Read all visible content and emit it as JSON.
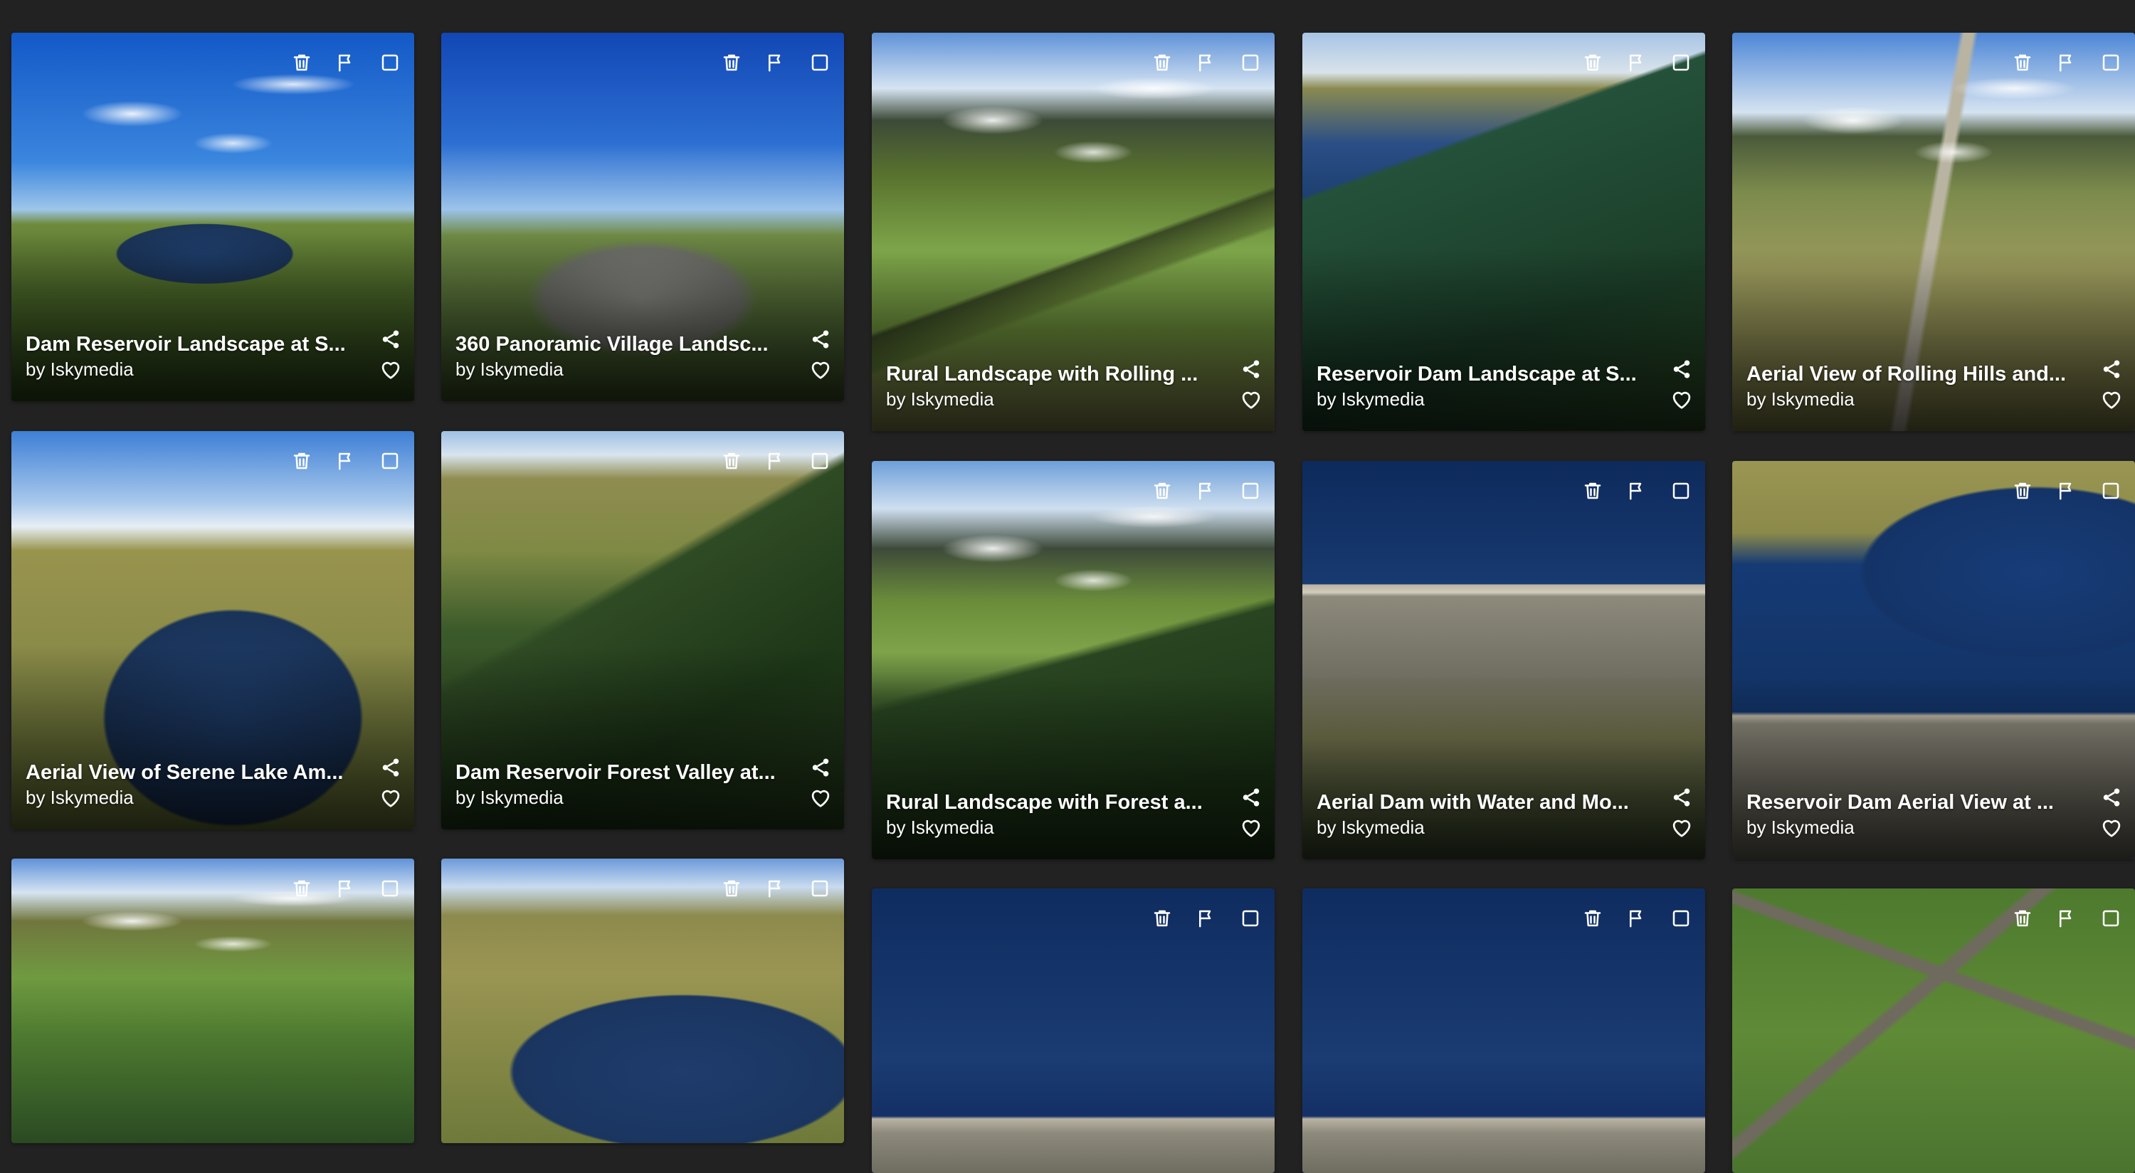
{
  "gallery": {
    "cards": [
      {
        "title": "Dam Reservoir Landscape at S...",
        "author": "by Iskymedia",
        "scene": "reservoir-dam-blue-sky"
      },
      {
        "title": "360 Panoramic Village Landsc...",
        "author": "by Iskymedia",
        "scene": "village-panorama"
      },
      {
        "title": "Rural Landscape with Rolling ...",
        "author": "by Iskymedia",
        "scene": "valley-fields"
      },
      {
        "title": "Reservoir Dam Landscape at S...",
        "author": "by Iskymedia",
        "scene": "reservoir-forest"
      },
      {
        "title": "Aerial View of Rolling Hills and...",
        "author": "by Iskymedia",
        "scene": "moorland-road"
      },
      {
        "title": "Aerial View of Serene Lake Am...",
        "author": "by Iskymedia",
        "scene": "lake-hills"
      },
      {
        "title": "Dam Reservoir Forest Valley at...",
        "author": "by Iskymedia",
        "scene": "forest-valley"
      },
      {
        "title": "Rural Landscape with Forest a...",
        "author": "by Iskymedia",
        "scene": "valley-forest"
      },
      {
        "title": "Aerial Dam with Water and Mo...",
        "author": "by Iskymedia",
        "scene": "dam-wall"
      },
      {
        "title": "Reservoir Dam Aerial View at ...",
        "author": "by Iskymedia",
        "scene": "reservoir-dam-top"
      },
      {
        "title": "",
        "author": "",
        "scene": "valley-green"
      },
      {
        "title": "",
        "author": "",
        "scene": "lake-moor"
      },
      {
        "title": "",
        "author": "",
        "scene": "dam-water"
      },
      {
        "title": "",
        "author": "",
        "scene": "dam-water"
      },
      {
        "title": "",
        "author": "",
        "scene": "campsite"
      }
    ],
    "icons": {
      "delete": "trash-icon",
      "report": "flag-icon",
      "select": "checkbox-icon",
      "share": "share-icon",
      "like": "heart-icon"
    }
  }
}
